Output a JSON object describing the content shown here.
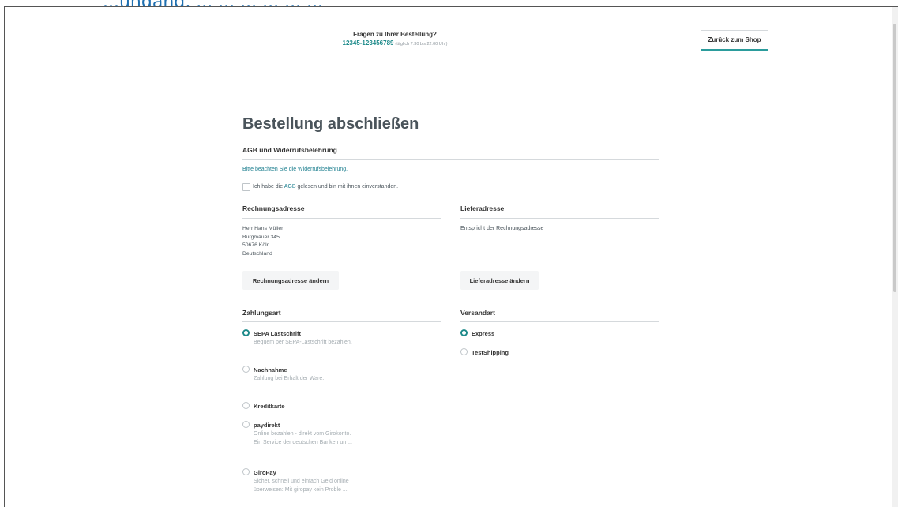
{
  "top_banner": {
    "text": "...ungang, ... ... ... ... ... ..."
  },
  "help": {
    "question": "Fragen zu Ihrer Bestellung?",
    "phone": "12345-123456789",
    "hours": "(täglich 7:30 bis 22:00 Uhr)"
  },
  "header": {
    "back_label": "Zurück zum Shop"
  },
  "page_title": "Bestellung abschließen",
  "agb": {
    "heading": "AGB und Widerrufsbelehrung",
    "notice": "Bitte beachten Sie die Widerrufsbelehrung.",
    "checkbox_before": "Ich habe die ",
    "checkbox_link": "AGB",
    "checkbox_after": " gelesen und bin mit ihnen einverstanden."
  },
  "billing": {
    "heading": "Rechnungsadresse",
    "lines": [
      "Herr Hans Müller",
      "Burgmauer 345",
      "50676 Köln",
      "Deutschland"
    ],
    "change_label": "Rechnungsadresse ändern"
  },
  "shipping_address": {
    "heading": "Lieferadresse",
    "text": "Entspricht der Rechnungsadresse",
    "change_label": "Lieferadresse ändern"
  },
  "payment": {
    "heading": "Zahlungsart",
    "options": [
      {
        "label": "SEPA Lastschrift",
        "desc": [
          "Bequem per SEPA-Lastschrift bezahlen."
        ],
        "selected": true
      },
      {
        "label": "Nachnahme",
        "desc": [
          "Zahlung bei Erhalt der Ware."
        ],
        "selected": false
      },
      {
        "label": "Kreditkarte",
        "desc": [],
        "selected": false
      },
      {
        "label": "paydirekt",
        "desc": [
          "Online bezahlen - direkt vom Girokonto.",
          "Ein Service der deutschen Banken un ..."
        ],
        "selected": false
      },
      {
        "label": "GiroPay",
        "desc": [
          "Sicher, schnell und einfach Geld online",
          "überweisen: Mit giropay kein Proble ..."
        ],
        "selected": false
      }
    ]
  },
  "shipping_method": {
    "heading": "Versandart",
    "options": [
      {
        "label": "Express",
        "selected": true
      },
      {
        "label": "TestShipping",
        "selected": false
      }
    ]
  },
  "colors": {
    "accent": "#1d8a8a",
    "link": "#1d7f8f",
    "text": "#4a545b"
  }
}
